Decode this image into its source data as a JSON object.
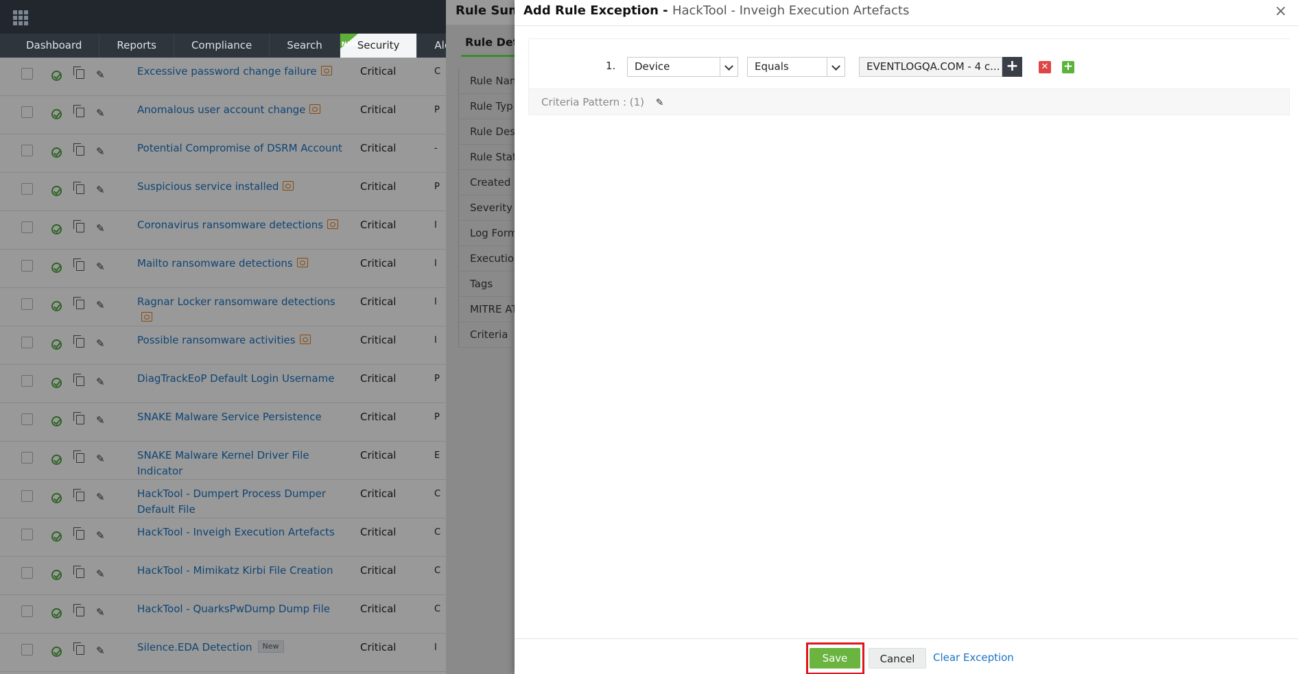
{
  "nav": {
    "tabs": [
      {
        "label": "Dashboard"
      },
      {
        "label": "Reports"
      },
      {
        "label": "Compliance"
      },
      {
        "label": "Search"
      },
      {
        "label": "Security",
        "new_badge": "NEW"
      },
      {
        "label": "Alerts"
      }
    ]
  },
  "rules": [
    {
      "name": "Excessive password change failure",
      "severity": "Critical",
      "category": "C",
      "rule_icon": true
    },
    {
      "name": "Anomalous user account change",
      "severity": "Critical",
      "category": "P",
      "rule_icon": true
    },
    {
      "name": "Potential Compromise of DSRM Account",
      "severity": "Critical",
      "category": "-",
      "rule_icon": false
    },
    {
      "name": "Suspicious service installed",
      "severity": "Critical",
      "category": "P",
      "rule_icon": true
    },
    {
      "name": "Coronavirus ransomware detections",
      "severity": "Critical",
      "category": "I",
      "rule_icon": true
    },
    {
      "name": "Mailto ransomware detections",
      "severity": "Critical",
      "category": "I",
      "rule_icon": true
    },
    {
      "name": "Ragnar Locker ransomware detections",
      "severity": "Critical",
      "category": "I",
      "rule_icon": true
    },
    {
      "name": "Possible ransomware activities",
      "severity": "Critical",
      "category": "I",
      "rule_icon": true
    },
    {
      "name": "DiagTrackEoP Default Login Username",
      "severity": "Critical",
      "category": "P",
      "rule_icon": false
    },
    {
      "name": "SNAKE Malware Service Persistence",
      "severity": "Critical",
      "category": "P",
      "rule_icon": false
    },
    {
      "name": "SNAKE Malware Kernel Driver File Indicator",
      "severity": "Critical",
      "category": "E",
      "rule_icon": false
    },
    {
      "name": "HackTool - Dumpert Process Dumper Default File",
      "severity": "Critical",
      "category": "C",
      "rule_icon": false
    },
    {
      "name": "HackTool - Inveigh Execution Artefacts",
      "severity": "Critical",
      "category": "C",
      "rule_icon": false
    },
    {
      "name": "HackTool - Mimikatz Kirbi File Creation",
      "severity": "Critical",
      "category": "C",
      "rule_icon": false
    },
    {
      "name": "HackTool - QuarksPwDump Dump File",
      "severity": "Critical",
      "category": "C",
      "rule_icon": false
    },
    {
      "name": "Silence.EDA Detection",
      "severity": "Critical",
      "category": "I",
      "rule_icon": false,
      "badge": "New"
    }
  ],
  "summary": {
    "title": "Rule Summ",
    "tab": "Rule Deta",
    "labels": [
      "Rule Nan",
      "Rule Typ",
      "Rule Descripti",
      "Rule Stat",
      "Created I",
      "Severity",
      "Log Form",
      "Execution Type",
      "Tags",
      "MITRE ATT&CK",
      "Criteria"
    ]
  },
  "modal": {
    "title": "Add Rule Exception -",
    "subtitle": "HackTool - Inveigh Execution Artefacts",
    "row_number": "1.",
    "field": "Device",
    "operator": "Equals",
    "value": "EVENTLOGQA.COM - 4 c...",
    "criteria_pattern": "Criteria Pattern : (1)",
    "save": "Save",
    "cancel": "Cancel",
    "clear": "Clear Exception"
  }
}
